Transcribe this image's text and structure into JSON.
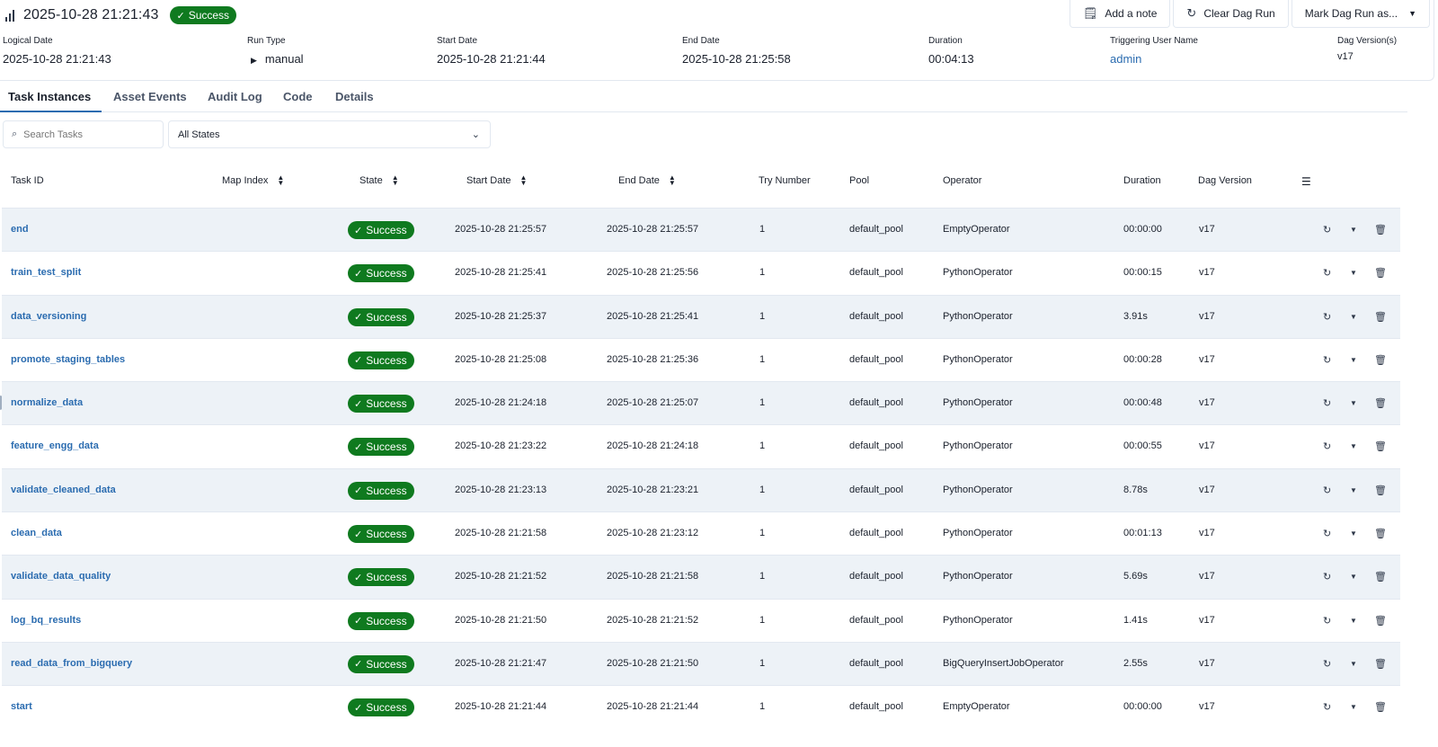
{
  "header": {
    "title": "2025-10-28 21:21:43",
    "status": "Success",
    "buttons": {
      "add_note": "Add a note",
      "clear_run": "Clear Dag Run",
      "mark_run": "Mark Dag Run as..."
    }
  },
  "meta": {
    "logical_date": {
      "label": "Logical Date",
      "value": "2025-10-28 21:21:43"
    },
    "run_type": {
      "label": "Run Type",
      "value": "manual"
    },
    "start_date": {
      "label": "Start Date",
      "value": "2025-10-28 21:21:44"
    },
    "end_date": {
      "label": "End Date",
      "value": "2025-10-28 21:25:58"
    },
    "duration": {
      "label": "Duration",
      "value": "00:04:13"
    },
    "triggering_user": {
      "label": "Triggering User Name",
      "value": "admin"
    },
    "dag_version": {
      "label": "Dag Version(s)",
      "value": "v17"
    }
  },
  "tabs": [
    "Task Instances",
    "Asset Events",
    "Audit Log",
    "Code",
    "Details"
  ],
  "filters": {
    "search_placeholder": "Search Tasks",
    "state_select": "All States"
  },
  "table": {
    "columns": [
      "Task ID",
      "Map Index",
      "State",
      "Start Date",
      "End Date",
      "Try Number",
      "Pool",
      "Operator",
      "Duration",
      "Dag Version"
    ],
    "rows": [
      {
        "task": "end",
        "state": "Success",
        "start": "2025-10-28 21:25:57",
        "end": "2025-10-28 21:25:57",
        "try": "1",
        "pool": "default_pool",
        "operator": "EmptyOperator",
        "duration": "00:00:00",
        "version": "v17"
      },
      {
        "task": "train_test_split",
        "state": "Success",
        "start": "2025-10-28 21:25:41",
        "end": "2025-10-28 21:25:56",
        "try": "1",
        "pool": "default_pool",
        "operator": "PythonOperator",
        "duration": "00:00:15",
        "version": "v17"
      },
      {
        "task": "data_versioning",
        "state": "Success",
        "start": "2025-10-28 21:25:37",
        "end": "2025-10-28 21:25:41",
        "try": "1",
        "pool": "default_pool",
        "operator": "PythonOperator",
        "duration": "3.91s",
        "version": "v17"
      },
      {
        "task": "promote_staging_tables",
        "state": "Success",
        "start": "2025-10-28 21:25:08",
        "end": "2025-10-28 21:25:36",
        "try": "1",
        "pool": "default_pool",
        "operator": "PythonOperator",
        "duration": "00:00:28",
        "version": "v17"
      },
      {
        "task": "normalize_data",
        "state": "Success",
        "start": "2025-10-28 21:24:18",
        "end": "2025-10-28 21:25:07",
        "try": "1",
        "pool": "default_pool",
        "operator": "PythonOperator",
        "duration": "00:00:48",
        "version": "v17"
      },
      {
        "task": "feature_engg_data",
        "state": "Success",
        "start": "2025-10-28 21:23:22",
        "end": "2025-10-28 21:24:18",
        "try": "1",
        "pool": "default_pool",
        "operator": "PythonOperator",
        "duration": "00:00:55",
        "version": "v17"
      },
      {
        "task": "validate_cleaned_data",
        "state": "Success",
        "start": "2025-10-28 21:23:13",
        "end": "2025-10-28 21:23:21",
        "try": "1",
        "pool": "default_pool",
        "operator": "PythonOperator",
        "duration": "8.78s",
        "version": "v17"
      },
      {
        "task": "clean_data",
        "state": "Success",
        "start": "2025-10-28 21:21:58",
        "end": "2025-10-28 21:23:12",
        "try": "1",
        "pool": "default_pool",
        "operator": "PythonOperator",
        "duration": "00:01:13",
        "version": "v17"
      },
      {
        "task": "validate_data_quality",
        "state": "Success",
        "start": "2025-10-28 21:21:52",
        "end": "2025-10-28 21:21:58",
        "try": "1",
        "pool": "default_pool",
        "operator": "PythonOperator",
        "duration": "5.69s",
        "version": "v17"
      },
      {
        "task": "log_bq_results",
        "state": "Success",
        "start": "2025-10-28 21:21:50",
        "end": "2025-10-28 21:21:52",
        "try": "1",
        "pool": "default_pool",
        "operator": "PythonOperator",
        "duration": "1.41s",
        "version": "v17"
      },
      {
        "task": "read_data_from_bigquery",
        "state": "Success",
        "start": "2025-10-28 21:21:47",
        "end": "2025-10-28 21:21:50",
        "try": "1",
        "pool": "default_pool",
        "operator": "BigQueryInsertJobOperator",
        "duration": "2.55s",
        "version": "v17"
      },
      {
        "task": "start",
        "state": "Success",
        "start": "2025-10-28 21:21:44",
        "end": "2025-10-28 21:21:44",
        "try": "1",
        "pool": "default_pool",
        "operator": "EmptyOperator",
        "duration": "00:00:00",
        "version": "v17"
      }
    ]
  },
  "colors": {
    "success": "#0f7a1f",
    "link": "#2b6cb0",
    "row_alt": "#edf2f7"
  }
}
